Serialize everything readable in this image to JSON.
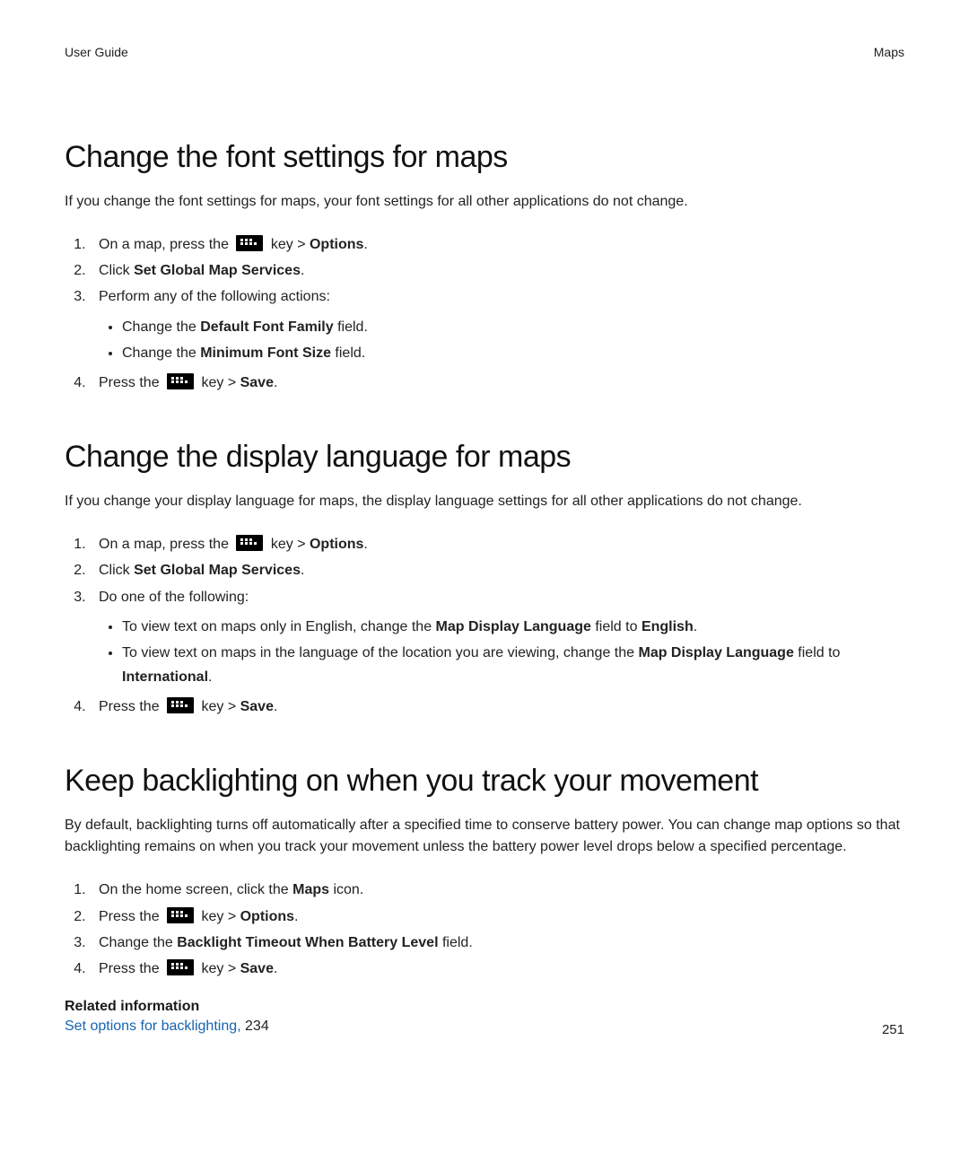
{
  "header": {
    "left": "User Guide",
    "right": "Maps"
  },
  "page_number": "251",
  "sections": [
    {
      "title": "Change the font settings for maps",
      "intro": "If you change the font settings for maps, your font settings for all other applications do not change.",
      "steps": {
        "s1_a": "On a map, press the ",
        "s1_b": " key > ",
        "s1_c": "Options",
        "s1_d": ".",
        "s2_a": "Click ",
        "s2_b": "Set Global Map Services",
        "s2_c": ".",
        "s3": "Perform any of the following actions:",
        "b1_a": "Change the ",
        "b1_b": "Default Font Family",
        "b1_c": " field.",
        "b2_a": "Change the ",
        "b2_b": "Minimum Font Size",
        "b2_c": " field.",
        "s4_a": "Press the ",
        "s4_b": " key > ",
        "s4_c": "Save",
        "s4_d": "."
      }
    },
    {
      "title": "Change the display language for maps",
      "intro": "If you change your display language for maps, the display language settings for all other applications do not change.",
      "steps": {
        "s1_a": "On a map, press the ",
        "s1_b": " key > ",
        "s1_c": "Options",
        "s1_d": ".",
        "s2_a": "Click ",
        "s2_b": "Set Global Map Services",
        "s2_c": ".",
        "s3": "Do one of the following:",
        "b1_a": "To view text on maps only in English, change the ",
        "b1_b": "Map Display Language",
        "b1_c": " field to ",
        "b1_d": "English",
        "b1_e": ".",
        "b2_a": "To view text on maps in the language of the location you are viewing, change the ",
        "b2_b": "Map Display Language",
        "b2_c": " field to ",
        "b2_d": "International",
        "b2_e": ".",
        "s4_a": "Press the ",
        "s4_b": " key > ",
        "s4_c": "Save",
        "s4_d": "."
      }
    },
    {
      "title": "Keep backlighting on when you track your movement",
      "intro": "By default, backlighting turns off automatically after a specified time to conserve battery power. You can change map options so that backlighting remains on when you track your movement unless the battery power level drops below a specified percentage.",
      "steps": {
        "s1_a": "On the home screen, click the ",
        "s1_b": "Maps",
        "s1_c": " icon.",
        "s2_a": "Press the ",
        "s2_b": " key > ",
        "s2_c": "Options",
        "s2_d": ".",
        "s3_a": "Change the ",
        "s3_b": "Backlight Timeout When Battery Level",
        "s3_c": " field.",
        "s4_a": "Press the ",
        "s4_b": " key > ",
        "s4_c": "Save",
        "s4_d": "."
      },
      "related": {
        "title": "Related information",
        "link_text": "Set options for backlighting, ",
        "page": "234"
      }
    }
  ]
}
